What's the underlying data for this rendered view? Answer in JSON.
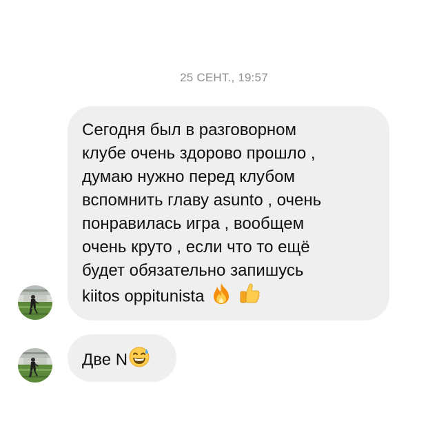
{
  "thread": {
    "timestamp": "25 СЕНТ., 19:57"
  },
  "messages": [
    {
      "lines": [
        "Сегодня был в разговорном",
        "клубе очень здорово прошло ,",
        "думаю нужно перед клубом",
        "вспомнить главу asunto ,  очень",
        "понравилась игра , вообщем",
        "очень круто , если что то ещё",
        "будет обязательно запишусь",
        "kiitos oppitunista"
      ],
      "emojis": [
        "fire-emoji",
        "thumbs-up-emoji"
      ]
    },
    {
      "text": "Две N",
      "emojis": [
        "grinning-sweat-emoji"
      ]
    }
  ],
  "avatar": {
    "icon": "avatar-photo-soccer-field"
  }
}
